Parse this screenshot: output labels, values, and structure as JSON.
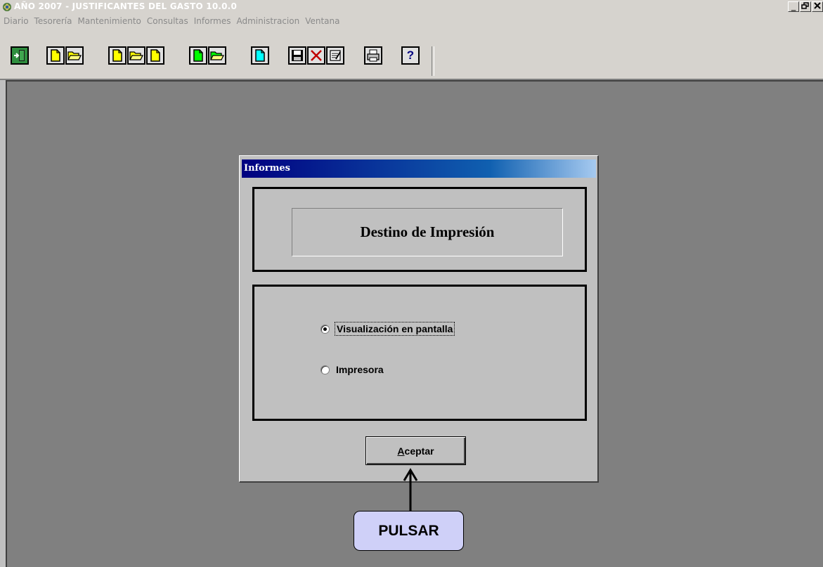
{
  "window": {
    "title": "AÑO 2007 - JUSTIFICANTES DEL GASTO 10.0.0",
    "controls": [
      "_",
      "🗗",
      "✕"
    ]
  },
  "menu": [
    "Diario",
    "Tesorería",
    "Mantenimiento",
    "Consultas",
    "Informes",
    "Administracion",
    "Ventana"
  ],
  "toolbar": {
    "buttons": [
      {
        "name": "exit-icon"
      },
      {
        "name": "new-doc-icon"
      },
      {
        "name": "open-folder-icon"
      },
      {
        "name": "new-doc-icon"
      },
      {
        "name": "open-folder-icon"
      },
      {
        "name": "new-doc-icon"
      },
      {
        "name": "new-doc-green-icon"
      },
      {
        "name": "open-folder-icon"
      },
      {
        "name": "new-doc-cyan-icon"
      },
      {
        "name": "save-disk-icon"
      },
      {
        "name": "delete-x-icon"
      },
      {
        "name": "edit-notes-icon"
      },
      {
        "name": "printer-icon"
      },
      {
        "name": "help-question-icon"
      }
    ],
    "help_glyph": "?"
  },
  "dialog": {
    "title": "Informes",
    "heading": "Destino de Impresión",
    "options": [
      {
        "label": "Visualización en pantalla",
        "selected": true
      },
      {
        "label": "Impresora",
        "selected": false
      }
    ],
    "accept_accel": "A",
    "accept_rest": "ceptar"
  },
  "annotation": {
    "callout": "PULSAR"
  },
  "colors": {
    "desktop": "#808080",
    "dialog_caption": "#000080",
    "callout_fill": "#cfd0f8",
    "doc_yellow": "#ffff00",
    "doc_green": "#00ff00",
    "doc_cyan": "#00ffff"
  }
}
